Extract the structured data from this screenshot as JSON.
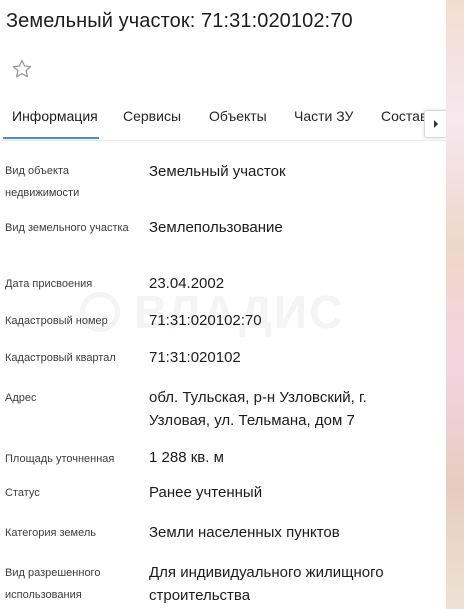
{
  "page": {
    "title": "Земельный участок: 71:31:020102:70"
  },
  "icons": {
    "favorite": "star-outline-icon",
    "tabs_next": "chevron-right-icon"
  },
  "tabs": [
    {
      "label": "Информация",
      "active": true
    },
    {
      "label": "Сервисы",
      "active": false
    },
    {
      "label": "Объекты",
      "active": false
    },
    {
      "label": "Части ЗУ",
      "active": false
    },
    {
      "label": "Состав",
      "active": false
    }
  ],
  "details": [
    {
      "label": "Вид объекта недвижимости",
      "value": "Земельный участок"
    },
    {
      "label": "Вид земельного участка",
      "value": "Землепользование"
    },
    {
      "label": "Дата присвоения",
      "value": "23.04.2002"
    },
    {
      "label": "Кадастровый номер",
      "value": "71:31:020102:70"
    },
    {
      "label": "Кадастровый квартал",
      "value": "71:31:020102"
    },
    {
      "label": "Адрес",
      "value": "обл. Тульская, р-н Узловский, г. Узловая, ул. Тельмана, дом 7"
    },
    {
      "label": "Площадь уточненная",
      "value": "1 288 кв. м"
    },
    {
      "label": "Статус",
      "value": "Ранее учтенный"
    },
    {
      "label": "Категория земель",
      "value": "Земли населенных пунктов"
    },
    {
      "label": "Вид разрешенного использования",
      "value": "Для индивидуального жилищного строительства"
    }
  ],
  "watermark": {
    "text": "ВЛАДИС"
  },
  "colors": {
    "tab_accent": "#4a8ed9",
    "star_outline": "#9a9a9a"
  }
}
